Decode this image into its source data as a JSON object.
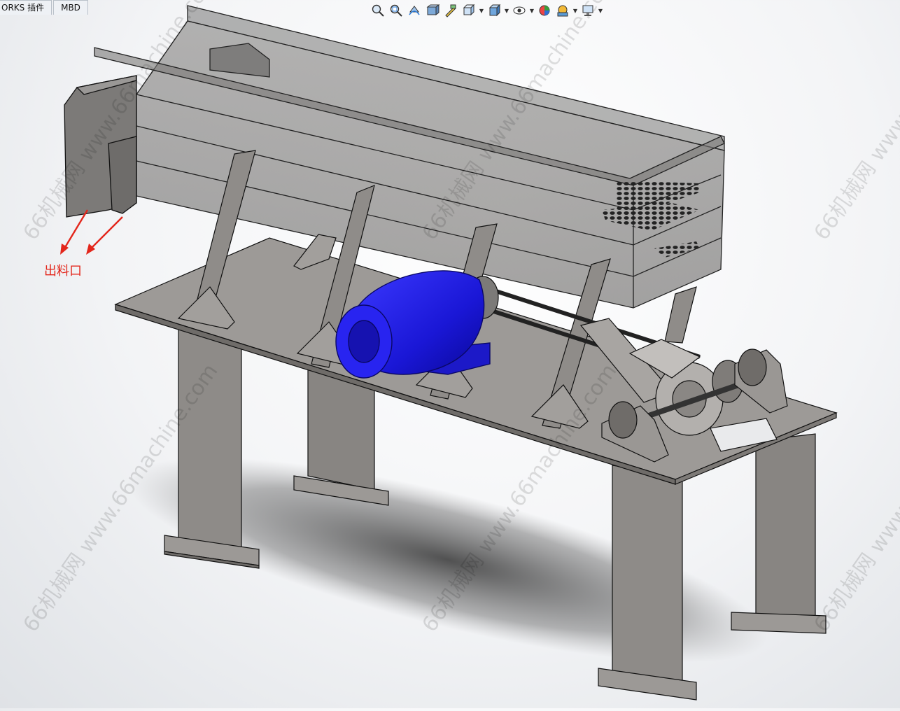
{
  "tabs": [
    {
      "label": "ORKS 插件"
    },
    {
      "label": "MBD"
    }
  ],
  "toolbar": {
    "icons": [
      "zoom-to-fit-icon",
      "zoom-to-area-icon",
      "previous-view-icon",
      "section-view-icon",
      "dynamic-annotation-icon",
      "view-orientation-icon",
      "display-style-icon",
      "hide-show-items-icon",
      "edit-appearance-icon",
      "apply-scene-icon",
      "view-settings-icon"
    ]
  },
  "annotation": {
    "label": "出料口",
    "color": "#e3261b"
  },
  "watermark": {
    "text": "66机械网 www.66machine.com"
  },
  "colors": {
    "motor": "#1f1ce0",
    "steel": "#9a9794",
    "frame_dark": "#6f6c69",
    "arrow": "#e3261b"
  }
}
